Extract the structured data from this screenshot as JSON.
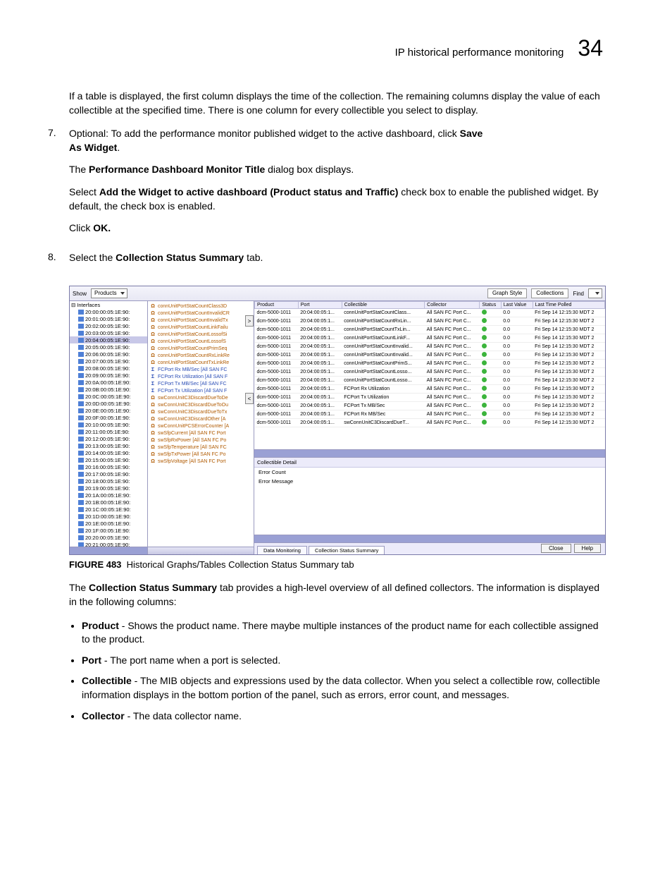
{
  "header": {
    "title": "IP historical performance monitoring",
    "chapter": "34"
  },
  "para_intro": "If a table is displayed, the first column displays the time of the collection. The remaining columns display the value of each collectible at the specified time. There is one column for every collectible you select to display.",
  "step7": {
    "num": "7.",
    "lead": "Optional: To add the performance monitor published widget to the active dashboard, click ",
    "save_as_widget_a": "Save",
    "save_as_widget_b": "As Widget",
    "dot1": ".",
    "line2a": "The ",
    "pdmt": "Performance Dashboard Monitor Title",
    "line2b": " dialog box displays.",
    "line3a": "Select ",
    "addwidget": "Add the Widget to active dashboard (Product status and Traffic)",
    "line3b": " check box to enable the published widget. By default, the check box is enabled.",
    "line4a": "Click ",
    "ok": "OK.",
    "": ""
  },
  "step8": {
    "num": "8.",
    "lead": "Select the ",
    "css": "Collection Status Summary",
    "tail": " tab."
  },
  "figure": {
    "label": "FIGURE 483",
    "caption": "Historical Graphs/Tables Collection Status Summary tab"
  },
  "after_fig_a": "The ",
  "after_fig_b": "Collection Status Summary",
  "after_fig_c": " tab provides a high-level overview of all defined collectors. The information is displayed in the following columns:",
  "bullets": {
    "b1a": "Product",
    "b1b": " - Shows the product name. There maybe multiple instances of the product name for each collectible assigned to the product.",
    "b2a": "Port",
    "b2b": " - The port name when a port is selected.",
    "b3a": "Collectible",
    "b3b": " - The MIB objects and expressions used by the data collector. When you select a collectible row, collectible information displays in the bottom portion of the panel, such as errors, error count, and messages.",
    "b4a": "Collector",
    "b4b": " - The data collector name."
  },
  "app": {
    "toolbar": {
      "show": "Show",
      "products": "Products",
      "graph_style": "Graph Style",
      "collections": "Collections",
      "find": "Find"
    },
    "tree_root": "Interfaces",
    "tree": [
      "20:00:00:05:1E:90:",
      "20:01:00:05:1E:90:",
      "20:02:00:05:1E:90:",
      "20:03:00:05:1E:90:",
      "20:04:00:05:1E:90:",
      "20:05:00:05:1E:90:",
      "20:06:00:05:1E:90:",
      "20:07:00:05:1E:90:",
      "20:08:00:05:1E:90:",
      "20:09:00:05:1E:90:",
      "20:0A:00:05:1E:90:",
      "20:0B:00:05:1E:90:",
      "20:0C:00:05:1E:90:",
      "20:0D:00:05:1E:90:",
      "20:0E:00:05:1E:90:",
      "20:0F:00:05:1E:90:",
      "20:10:00:05:1E:90:",
      "20:11:00:05:1E:90:",
      "20:12:00:05:1E:90:",
      "20:13:00:05:1E:90:",
      "20:14:00:05:1E:90:",
      "20:15:00:05:1E:90:",
      "20:16:00:05:1E:90:",
      "20:17:00:05:1E:90:",
      "20:18:00:05:1E:90:",
      "20:19:00:05:1E:90:",
      "20:1A:00:05:1E:90:",
      "20:1B:00:05:1E:90:",
      "20:1C:00:05:1E:90:",
      "20:1D:00:05:1E:90:",
      "20:1E:00:05:1E:90:",
      "20:1F:00:05:1E:90:",
      "20:20:00:05:1E:90:",
      "20:21:00:05:1E:90:"
    ],
    "tree_selected_index": 4,
    "metrics": [
      {
        "t": "o",
        "txt": "connUnitPortStatCountClass3D"
      },
      {
        "t": "o",
        "txt": "connUnitPortStatCountInvalidCR"
      },
      {
        "t": "o",
        "txt": "connUnitPortStatCountInvalidTx"
      },
      {
        "t": "o",
        "txt": "connUnitPortStatCountLinkFailu"
      },
      {
        "t": "o",
        "txt": "connUnitPortStatCountLossofSi"
      },
      {
        "t": "o",
        "txt": "connUnitPortStatCountLossofS"
      },
      {
        "t": "o",
        "txt": "connUnitPortStatCountPrimSeq"
      },
      {
        "t": "o",
        "txt": "connUnitPortStatCountRxLinkRe"
      },
      {
        "t": "o",
        "txt": "connUnitPortStatCountTxLinkRe"
      },
      {
        "t": "b",
        "txt": "FCPort Rx MB/Sec [All SAN FC"
      },
      {
        "t": "b",
        "txt": "FCPort Rx Utilization [All SAN F"
      },
      {
        "t": "b",
        "txt": "FCPort Tx MB/Sec [All SAN FC"
      },
      {
        "t": "b",
        "txt": "FCPort Tx Utilization [All SAN F"
      },
      {
        "t": "o",
        "txt": "swConnUnitC3DiscardDueToDe"
      },
      {
        "t": "o",
        "txt": "swConnUnitC3DiscardDueToOu"
      },
      {
        "t": "o",
        "txt": "swConnUnitC3DiscardDueToTx"
      },
      {
        "t": "o",
        "txt": "swConnUnitC3DiscardOther [A"
      },
      {
        "t": "o",
        "txt": "swConnUnitPCSErrorCounter [A"
      },
      {
        "t": "o",
        "txt": "swSfpCurrent [All SAN FC Port"
      },
      {
        "t": "o",
        "txt": "swSfpRxPower [All SAN FC Po"
      },
      {
        "t": "o",
        "txt": "swSfpTemperature [All SAN FC"
      },
      {
        "t": "o",
        "txt": "swSfpTxPower [All SAN FC Po"
      },
      {
        "t": "o",
        "txt": "swSfpVoltage [All SAN FC Port"
      }
    ],
    "grid_headers": [
      "Product",
      "Port",
      "Collectible",
      "Collector",
      "Status",
      "Last Value",
      "Last Time Polled"
    ],
    "grid_rows": [
      {
        "product": "dcm-5000-1011",
        "port": "20:04:00:05:1...",
        "coll": "connUnitPortStatCountClass...",
        "collector": "All SAN FC Port C...",
        "value": "0.0",
        "time": "Fri Sep 14 12:15:30 MDT 2"
      },
      {
        "product": "dcm-5000-1011",
        "port": "20:04:00:05:1...",
        "coll": "connUnitPortStatCountRxLin...",
        "collector": "All SAN FC Port C...",
        "value": "0.0",
        "time": "Fri Sep 14 12:15:30 MDT 2"
      },
      {
        "product": "dcm-5000-1011",
        "port": "20:04:00:05:1...",
        "coll": "connUnitPortStatCountTxLin...",
        "collector": "All SAN FC Port C...",
        "value": "0.0",
        "time": "Fri Sep 14 12:15:30 MDT 2"
      },
      {
        "product": "dcm-5000-1011",
        "port": "20:04:00:05:1...",
        "coll": "connUnitPortStatCountLinkF...",
        "collector": "All SAN FC Port C...",
        "value": "0.0",
        "time": "Fri Sep 14 12:15:30 MDT 2"
      },
      {
        "product": "dcm-5000-1011",
        "port": "20:04:00:05:1...",
        "coll": "connUnitPortStatCountInvalid...",
        "collector": "All SAN FC Port C...",
        "value": "0.0",
        "time": "Fri Sep 14 12:15:30 MDT 2"
      },
      {
        "product": "dcm-5000-1011",
        "port": "20:04:00:05:1...",
        "coll": "connUnitPortStatCountInvalid...",
        "collector": "All SAN FC Port C...",
        "value": "0.0",
        "time": "Fri Sep 14 12:15:30 MDT 2"
      },
      {
        "product": "dcm-5000-1011",
        "port": "20:04:00:05:1...",
        "coll": "connUnitPortStatCountPrimS...",
        "collector": "All SAN FC Port C...",
        "value": "0.0",
        "time": "Fri Sep 14 12:15:30 MDT 2"
      },
      {
        "product": "dcm-5000-1011",
        "port": "20:04:00:05:1...",
        "coll": "connUnitPortStatCountLosso...",
        "collector": "All SAN FC Port C...",
        "value": "0.0",
        "time": "Fri Sep 14 12:15:30 MDT 2"
      },
      {
        "product": "dcm-5000-1011",
        "port": "20:04:00:05:1...",
        "coll": "connUnitPortStatCountLosso...",
        "collector": "All SAN FC Port C...",
        "value": "0.0",
        "time": "Fri Sep 14 12:15:30 MDT 2"
      },
      {
        "product": "dcm-5000-1011",
        "port": "20:04:00:05:1...",
        "coll": "FCPort Rx Utilization",
        "collector": "All SAN FC Port C...",
        "value": "0.0",
        "time": "Fri Sep 14 12:15:30 MDT 2"
      },
      {
        "product": "dcm-5000-1011",
        "port": "20:04:00:05:1...",
        "coll": "FCPort Tx Utilization",
        "collector": "All SAN FC Port C...",
        "value": "0.0",
        "time": "Fri Sep 14 12:15:30 MDT 2"
      },
      {
        "product": "dcm-5000-1011",
        "port": "20:04:00:05:1...",
        "coll": "FCPort Tx MB/Sec",
        "collector": "All SAN FC Port C...",
        "value": "0.0",
        "time": "Fri Sep 14 12:15:30 MDT 2"
      },
      {
        "product": "dcm-5000-1011",
        "port": "20:04:00:05:1...",
        "coll": "FCPort Rx MB/Sec",
        "collector": "All SAN FC Port C...",
        "value": "0.0",
        "time": "Fri Sep 14 12:15:30 MDT 2"
      },
      {
        "product": "dcm-5000-1011",
        "port": "20:04:00:05:1...",
        "coll": "swConnUnitC3DiscardDueT...",
        "collector": "All SAN FC Port C...",
        "value": "0.0",
        "time": "Fri Sep 14 12:15:30 MDT 2"
      }
    ],
    "detail": {
      "header": "Collectible Detail",
      "row1": "Error Count",
      "row2": "Error Message"
    },
    "tabs": {
      "t1": "Data Monitoring",
      "t2": "Collection Status Summary"
    },
    "footer": {
      "close": "Close",
      "help": "Help"
    },
    "arrow_right": ">",
    "arrow_left": "<"
  }
}
